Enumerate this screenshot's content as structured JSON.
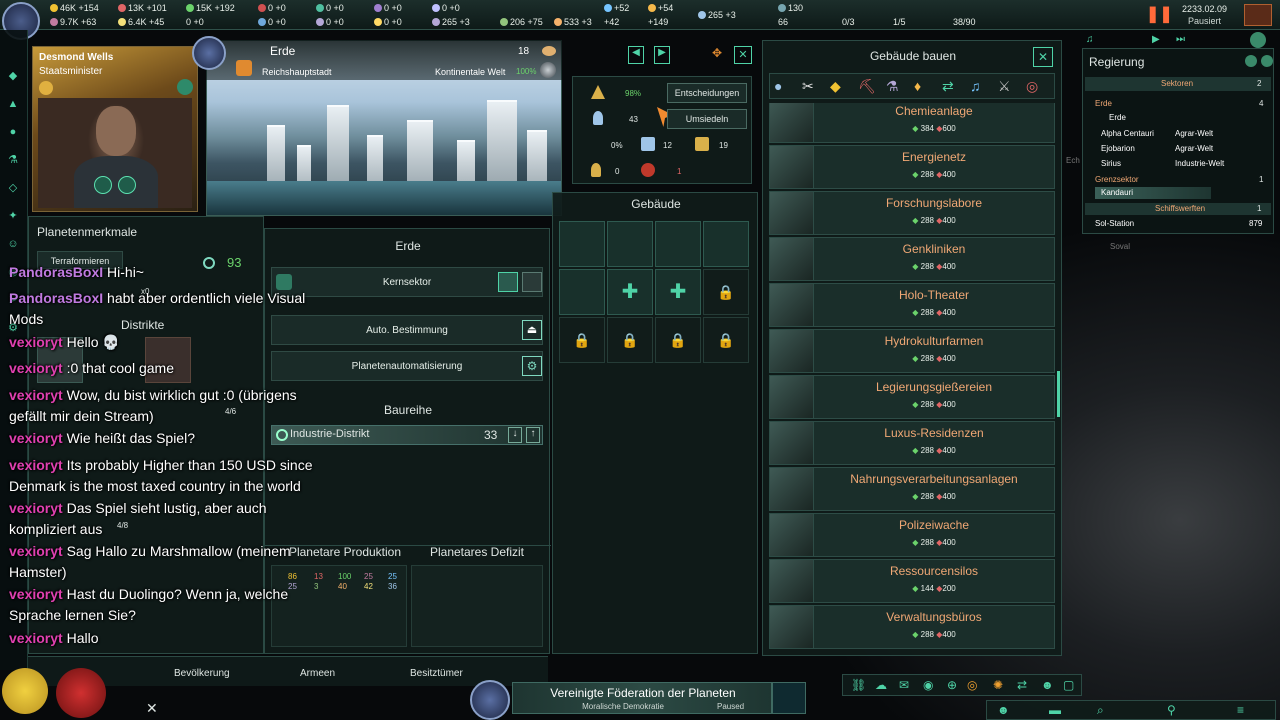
{
  "topbar": {
    "resources_row1": [
      "46K +154",
      "13K +101",
      "15K +192",
      "0 +0",
      "0 +0",
      "0 +0",
      "0 +0",
      "+52",
      "+54"
    ],
    "resources_row2": [
      "9.7K +63",
      "6.4K +45",
      "0 +0",
      "0 +0",
      "0 +0",
      "0 +0",
      "265 +3",
      "206 +75",
      "533 +3",
      "+42",
      "+149",
      "265 +3",
      "130",
      "66",
      "0/3",
      "1/5",
      "38/90"
    ],
    "date": "2233.02.09",
    "status": "Pausiert",
    "colors": {
      "energy": "#f1c232",
      "minerals": "#e06666",
      "food": "#6bd36b",
      "alloys": "#c27ba0",
      "unity": "#76c5ff"
    }
  },
  "leader": {
    "name": "Desmond Wells",
    "title": "Staatsminister"
  },
  "planet": {
    "name": "Erde",
    "size": "18",
    "capital": "Reichshauptstadt",
    "type": "Kontinentale Welt",
    "habitability": "100%",
    "traits_label": "Planetenmerkmale",
    "terraform_button": "Terraformieren",
    "amenities": "93",
    "x0": "x0",
    "districts_label": "Distrikte",
    "district_counts": [
      "4/6",
      "4/8"
    ]
  },
  "mid": {
    "title": "Erde",
    "sector": "Kernsektor",
    "auto_designation": "Auto. Bestimmung",
    "planet_automation": "Planetenautomatisierung",
    "queue_label": "Baureihe",
    "queue_item": "Industrie-Distrikt",
    "queue_count": "33",
    "production_label": "Planetare Produktion",
    "deficit_label": "Planetares Defizit",
    "production_values": [
      "86",
      "13",
      "100",
      "25",
      "25",
      "25",
      "3",
      "40",
      "42",
      "36"
    ]
  },
  "stats": {
    "stability": "98%",
    "pops": "43",
    "decisions": "Entscheidungen",
    "resettle": "Umsiedeln",
    "crime": "0%",
    "housing": "12",
    "jobs": "19",
    "free_jobs": "0",
    "unemployed": "1"
  },
  "buildings_label": "Gebäude",
  "build_list": {
    "title": "Gebäude bauen",
    "items": [
      {
        "name": "Chemieanlage",
        "energy": "384",
        "minerals": "600"
      },
      {
        "name": "Energienetz",
        "energy": "288",
        "minerals": "400"
      },
      {
        "name": "Forschungslabore",
        "energy": "288",
        "minerals": "400"
      },
      {
        "name": "Genkliniken",
        "energy": "288",
        "minerals": "400"
      },
      {
        "name": "Holo-Theater",
        "energy": "288",
        "minerals": "400"
      },
      {
        "name": "Hydrokulturfarmen",
        "energy": "288",
        "minerals": "400"
      },
      {
        "name": "Legierungsgießereien",
        "energy": "288",
        "minerals": "400"
      },
      {
        "name": "Luxus-Residenzen",
        "energy": "288",
        "minerals": "400"
      },
      {
        "name": "Nahrungsverarbeitungsanlagen",
        "energy": "288",
        "minerals": "400"
      },
      {
        "name": "Polizeiwache",
        "energy": "288",
        "minerals": "400"
      },
      {
        "name": "Ressourcensilos",
        "energy": "144",
        "minerals": "200"
      },
      {
        "name": "Verwaltungsbüros",
        "energy": "288",
        "minerals": "400"
      }
    ]
  },
  "government": {
    "title": "Regierung",
    "sectors_label": "Sektoren",
    "sectors_count": "2",
    "sector1": "Erde",
    "sector1_count": "4",
    "planets": [
      {
        "name": "Erde",
        "type": ""
      },
      {
        "name": "Alpha Centauri",
        "type": "Agrar-Welt"
      },
      {
        "name": "Ejobarion",
        "type": "Agrar-Welt"
      },
      {
        "name": "Sirius",
        "type": "Industrie-Welt"
      }
    ],
    "border_sector": "Grenzsektor",
    "border_count": "1",
    "border_planet": "Kandauri",
    "shipyards": "Schiffswerften",
    "shipyards_count": "1",
    "station": "Sol-Station",
    "station_value": "879",
    "map_labels": [
      "Ech",
      "Soval"
    ]
  },
  "chat": [
    {
      "user": "PandorasBoxI",
      "msg": "Hi-hi~"
    },
    {
      "user": "PandorasBoxI",
      "msg": "habt aber ordentlich viele Visual Mods"
    },
    {
      "user": "vexioryt",
      "msg": "Hello 💀"
    },
    {
      "user": "vexioryt",
      "msg": ":0 that cool game"
    },
    {
      "user": "vexioryt",
      "msg": "Wow, du bist wirklich gut :0 (übrigens gefällt mir dein Stream)"
    },
    {
      "user": "vexioryt",
      "msg": "Wie heißt das Spiel?"
    },
    {
      "user": "vexioryt",
      "msg": "Its probably Higher than 150 USD since Denmark is the most taxed country in the world"
    },
    {
      "user": "vexioryt",
      "msg": "Das Spiel sieht lustig, aber auch kompliziert aus"
    },
    {
      "user": "vexioryt",
      "msg": "Sag Hallo zu Marshmallow (meinem Hamster)"
    },
    {
      "user": "vexioryt",
      "msg": "Hast du Duolingo? Wenn ja, welche Sprache lernen Sie?"
    },
    {
      "user": "vexioryt",
      "msg": "Hallo"
    }
  ],
  "bottom": {
    "tabs": [
      "Bevölkerung",
      "Armeen",
      "Besitztümer"
    ],
    "empire": "Vereinigte Föderation der Planeten",
    "government_type": "Moralische Demokratie",
    "paused": "Paused"
  }
}
